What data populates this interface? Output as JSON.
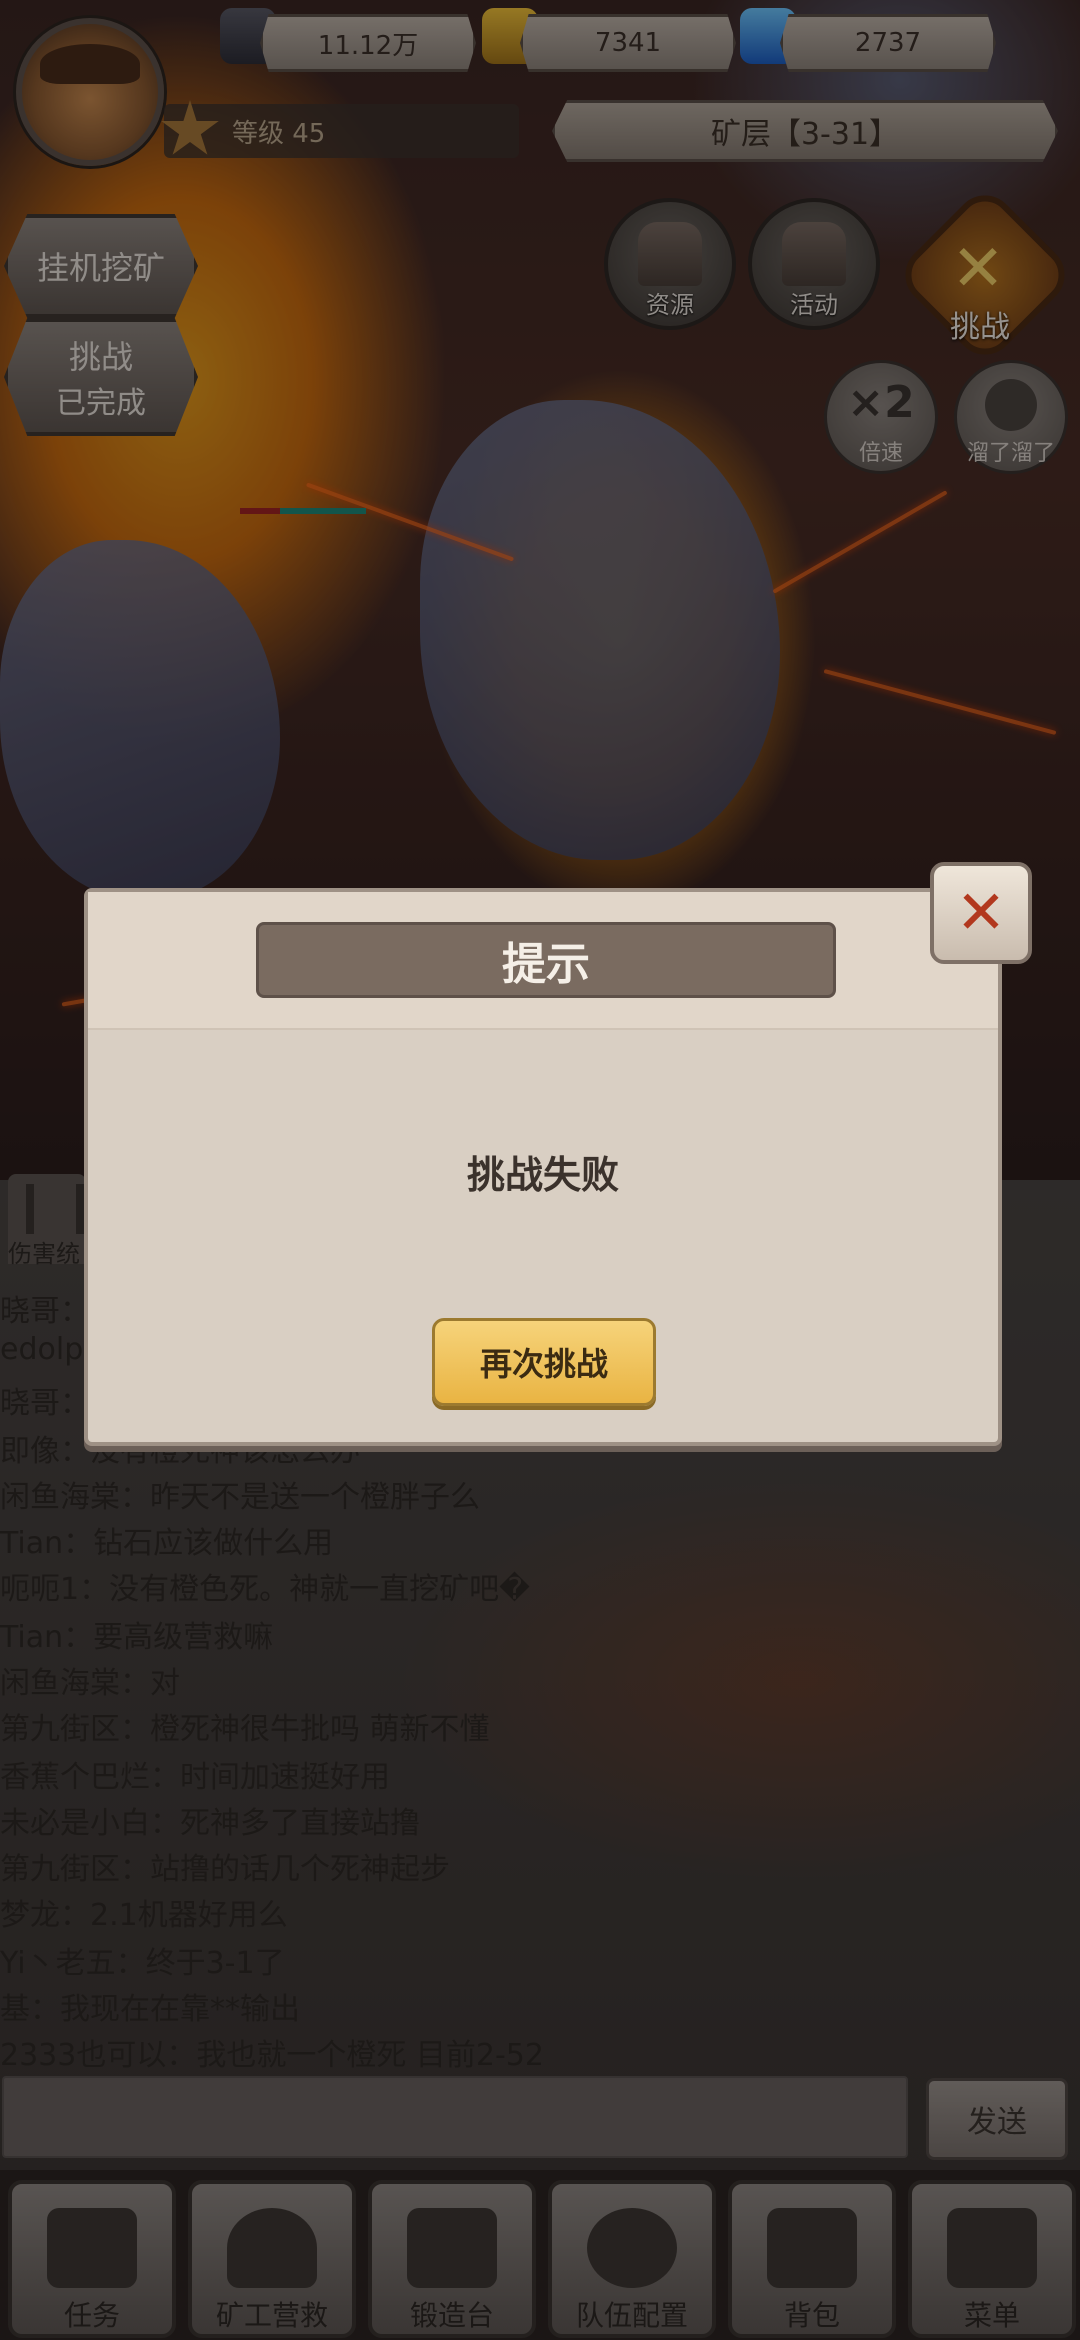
{
  "resources": {
    "stone": "11.12万",
    "gold": "7341",
    "gem": "2737"
  },
  "player": {
    "level_text": "等级 45"
  },
  "mine_layer": "矿层【3-31】",
  "left_buttons": {
    "idle_mining": "挂机挖矿",
    "challenge_title": "挑战",
    "challenge_status": "已完成"
  },
  "right_buttons": {
    "resources": "资源",
    "events": "活动",
    "challenge": "挑战",
    "speed_badge": "×2",
    "speed": "倍速",
    "escape": "溜了溜了"
  },
  "chat": {
    "tab": "伤害统",
    "lines": [
      "晓哥：",
      "edolp",
      "晓哥：",
      "即像：没有橙死神该怎么办",
      "闲鱼海棠：昨天不是送一个橙胖子么",
      "Tian：钻石应该做什么用",
      "呃呃1：没有橙色死。神就一直挖矿吧�",
      "Tian：要高级营救嘛",
      "闲鱼海棠：对",
      "第九街区：橙死神很牛批吗 萌新不懂",
      "香蕉个巴烂：时间加速挺好用",
      "未必是小白：死神多了直接站撸",
      "第九街区：站撸的话几个死神起步",
      "梦龙：2.1机器好用么",
      "Yi丶老五：终于3-1了",
      "基：我现在在靠**输出",
      "2333也可以：我也就一个橙死  目前2-52"
    ],
    "input_value": "",
    "send_label": "发送"
  },
  "nav": {
    "tasks": "任务",
    "rescue": "矿工营救",
    "forge": "锻造台",
    "team": "队伍配置",
    "bag": "背包",
    "menu": "菜单"
  },
  "modal": {
    "title": "提示",
    "message": "挑战失败",
    "retry": "再次挑战"
  },
  "colors": {
    "accent_gold": "#e9b443",
    "close_red": "#b2381e"
  }
}
